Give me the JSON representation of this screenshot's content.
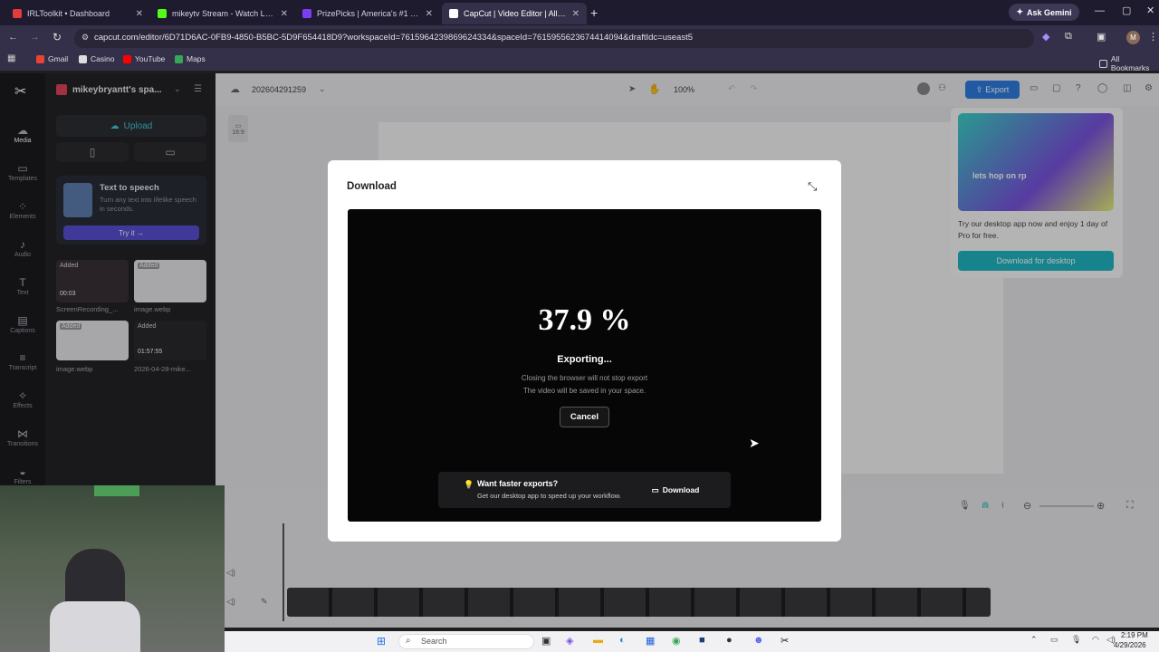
{
  "browser": {
    "tabs": [
      {
        "label": "IRLToolkit • Dashboard",
        "color": "#e23b3b"
      },
      {
        "label": "mikeytv Stream - Watch Live on",
        "color": "#53fc18"
      },
      {
        "label": "PrizePicks | America's #1 Fanta",
        "color": "#7b3ff2"
      },
      {
        "label": "CapCut | Video Editor | All-In-O",
        "color": "#ffffff",
        "active": true
      }
    ],
    "new_tab": "+",
    "ask_gemini": "Ask Gemini",
    "url": "capcut.com/editor/6D71D6AC-0FB9-4850-B5BC-5D9F654418D9?workspaceId=7615964239869624334&spaceId=7615955623674414094&draftIdc=useast5",
    "bookmarks": [
      "Gmail",
      "Casino",
      "YouTube",
      "Maps"
    ],
    "all_bookmarks": "All Bookmarks",
    "profile_initial": "M"
  },
  "editor": {
    "workspace": "mikeybryantt's spa...",
    "project_name": "202604291259",
    "zoom": "100%",
    "export_label": "Export",
    "aspect": "16:9",
    "rail": [
      "Media",
      "Templates",
      "Elements",
      "Audio",
      "Text",
      "Captions",
      "Transcript",
      "Effects",
      "Transitions",
      "Filters"
    ],
    "upload_label": "Upload",
    "tts": {
      "title": "Text to speech",
      "desc": "Turn any text into lifelike speech in seconds.",
      "try": "Try it →"
    },
    "media": [
      {
        "badge": "Added",
        "name": "ScreenRecording_...",
        "duration": "00:03"
      },
      {
        "badge": "Added",
        "name": "image.webp",
        "duration": ""
      },
      {
        "badge": "Added",
        "name": "image.webp",
        "duration": ""
      },
      {
        "badge": "Added",
        "name": "2026-04-28-mike...",
        "duration": "01:57:55"
      }
    ],
    "promo": {
      "banner": "lets hop on rp",
      "text": "Try our desktop app now and enjoy 1 day of Pro for free.",
      "button": "Download for desktop"
    }
  },
  "dialog": {
    "title": "Download",
    "percent": "37.9 %",
    "progress": 0.379,
    "status": "Exporting...",
    "note1": "Closing the browser will not stop export",
    "note2": "The video will be saved in your space.",
    "cancel": "Cancel",
    "faster_title": "Want faster exports?",
    "faster_desc": "Get our desktop app to speed up your workflow.",
    "faster_button": "Download"
  },
  "taskbar": {
    "search": "Search",
    "time": "2:19 PM",
    "date": "4/29/2026"
  }
}
